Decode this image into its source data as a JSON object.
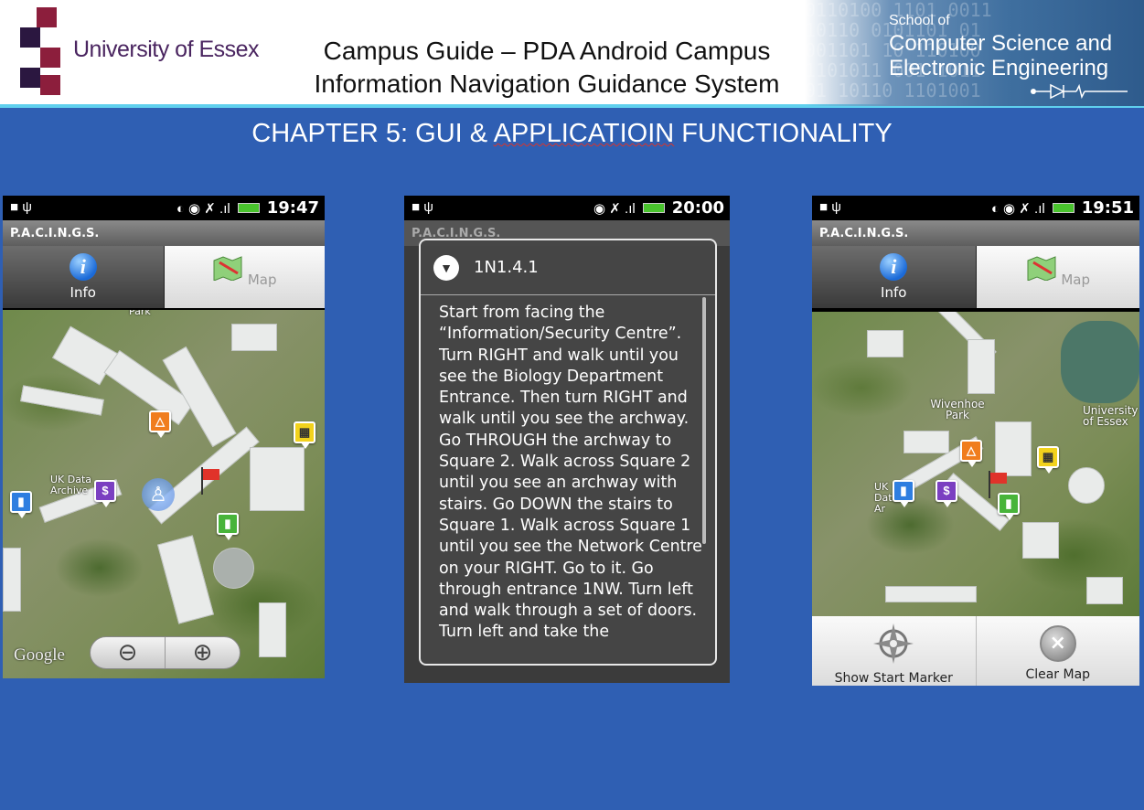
{
  "header": {
    "university": "University of Essex",
    "title_line1": "Campus Guide – PDA Android Campus",
    "title_line2": "Information Navigation Guidance System",
    "school_small": "School of",
    "school_line1": "Computer Science and",
    "school_line2": "Electronic Engineering"
  },
  "chapter": {
    "prefix": "CHAPTER 5: GUI & ",
    "word": "APPLICATIOIN",
    "suffix": " FUNCTIONALITY"
  },
  "phones": [
    {
      "time": "19:47",
      "app_title": "P.A.C.I.N.G.S.",
      "tabs": [
        "Info",
        "Map"
      ],
      "map_labels": [
        "Park",
        "UK Data Archive"
      ],
      "google": "Google",
      "zoom_out": "⊖",
      "zoom_in": "⊕"
    },
    {
      "time": "20:00",
      "app_title": "P.A.C.I.N.G.S.",
      "dialog_title": "1N1.4.1",
      "dialog_text": "Start from facing the “Information/Security Centre”. Turn RIGHT and walk until you see the Biology Department Entrance. Then turn RIGHT and walk until you see the archway. Go THROUGH the archway to Square 2. Walk across Square 2 until you see an archway with stairs. Go DOWN the stairs to Square 1. Walk across Square 1 until you see the Network Centre on your RIGHT. Go to it. Go through entrance 1NW. Turn left and walk through a set of doors. Turn left and take the"
    },
    {
      "time": "19:51",
      "app_title": "P.A.C.I.N.G.S.",
      "tabs": [
        "Info",
        "Map"
      ],
      "map_labels": [
        "Wivenhoe Park",
        "University of Essex",
        "UK Data Ar"
      ],
      "buttons": [
        "Show Start Marker",
        "Clear Map"
      ]
    }
  ],
  "colors": {
    "background": "#2f5fb3",
    "accent_line": "#5fd0ee",
    "university_purple": "#4a2560"
  }
}
